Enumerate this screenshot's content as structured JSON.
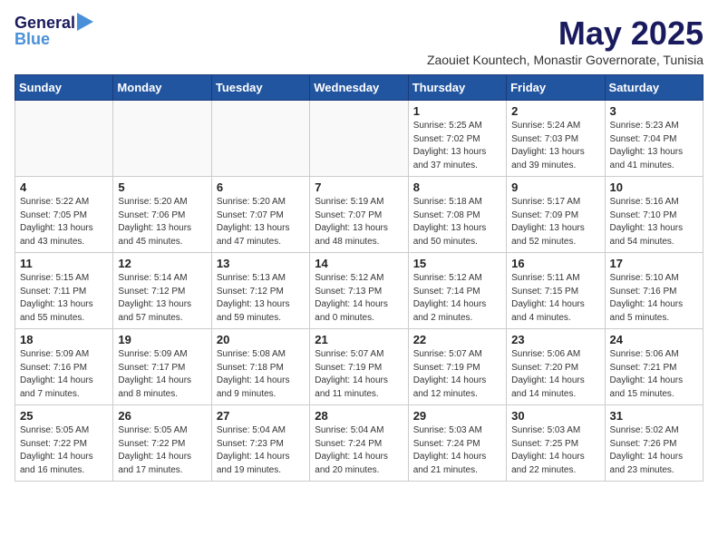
{
  "header": {
    "logo_line1": "General",
    "logo_line2": "Blue",
    "title": "May 2025",
    "subtitle": "Zaouiet Kountech, Monastir Governorate, Tunisia"
  },
  "weekdays": [
    "Sunday",
    "Monday",
    "Tuesday",
    "Wednesday",
    "Thursday",
    "Friday",
    "Saturday"
  ],
  "weeks": [
    [
      {
        "day": "",
        "info": ""
      },
      {
        "day": "",
        "info": ""
      },
      {
        "day": "",
        "info": ""
      },
      {
        "day": "",
        "info": ""
      },
      {
        "day": "1",
        "info": "Sunrise: 5:25 AM\nSunset: 7:02 PM\nDaylight: 13 hours\nand 37 minutes."
      },
      {
        "day": "2",
        "info": "Sunrise: 5:24 AM\nSunset: 7:03 PM\nDaylight: 13 hours\nand 39 minutes."
      },
      {
        "day": "3",
        "info": "Sunrise: 5:23 AM\nSunset: 7:04 PM\nDaylight: 13 hours\nand 41 minutes."
      }
    ],
    [
      {
        "day": "4",
        "info": "Sunrise: 5:22 AM\nSunset: 7:05 PM\nDaylight: 13 hours\nand 43 minutes."
      },
      {
        "day": "5",
        "info": "Sunrise: 5:20 AM\nSunset: 7:06 PM\nDaylight: 13 hours\nand 45 minutes."
      },
      {
        "day": "6",
        "info": "Sunrise: 5:20 AM\nSunset: 7:07 PM\nDaylight: 13 hours\nand 47 minutes."
      },
      {
        "day": "7",
        "info": "Sunrise: 5:19 AM\nSunset: 7:07 PM\nDaylight: 13 hours\nand 48 minutes."
      },
      {
        "day": "8",
        "info": "Sunrise: 5:18 AM\nSunset: 7:08 PM\nDaylight: 13 hours\nand 50 minutes."
      },
      {
        "day": "9",
        "info": "Sunrise: 5:17 AM\nSunset: 7:09 PM\nDaylight: 13 hours\nand 52 minutes."
      },
      {
        "day": "10",
        "info": "Sunrise: 5:16 AM\nSunset: 7:10 PM\nDaylight: 13 hours\nand 54 minutes."
      }
    ],
    [
      {
        "day": "11",
        "info": "Sunrise: 5:15 AM\nSunset: 7:11 PM\nDaylight: 13 hours\nand 55 minutes."
      },
      {
        "day": "12",
        "info": "Sunrise: 5:14 AM\nSunset: 7:12 PM\nDaylight: 13 hours\nand 57 minutes."
      },
      {
        "day": "13",
        "info": "Sunrise: 5:13 AM\nSunset: 7:12 PM\nDaylight: 13 hours\nand 59 minutes."
      },
      {
        "day": "14",
        "info": "Sunrise: 5:12 AM\nSunset: 7:13 PM\nDaylight: 14 hours\nand 0 minutes."
      },
      {
        "day": "15",
        "info": "Sunrise: 5:12 AM\nSunset: 7:14 PM\nDaylight: 14 hours\nand 2 minutes."
      },
      {
        "day": "16",
        "info": "Sunrise: 5:11 AM\nSunset: 7:15 PM\nDaylight: 14 hours\nand 4 minutes."
      },
      {
        "day": "17",
        "info": "Sunrise: 5:10 AM\nSunset: 7:16 PM\nDaylight: 14 hours\nand 5 minutes."
      }
    ],
    [
      {
        "day": "18",
        "info": "Sunrise: 5:09 AM\nSunset: 7:16 PM\nDaylight: 14 hours\nand 7 minutes."
      },
      {
        "day": "19",
        "info": "Sunrise: 5:09 AM\nSunset: 7:17 PM\nDaylight: 14 hours\nand 8 minutes."
      },
      {
        "day": "20",
        "info": "Sunrise: 5:08 AM\nSunset: 7:18 PM\nDaylight: 14 hours\nand 9 minutes."
      },
      {
        "day": "21",
        "info": "Sunrise: 5:07 AM\nSunset: 7:19 PM\nDaylight: 14 hours\nand 11 minutes."
      },
      {
        "day": "22",
        "info": "Sunrise: 5:07 AM\nSunset: 7:19 PM\nDaylight: 14 hours\nand 12 minutes."
      },
      {
        "day": "23",
        "info": "Sunrise: 5:06 AM\nSunset: 7:20 PM\nDaylight: 14 hours\nand 14 minutes."
      },
      {
        "day": "24",
        "info": "Sunrise: 5:06 AM\nSunset: 7:21 PM\nDaylight: 14 hours\nand 15 minutes."
      }
    ],
    [
      {
        "day": "25",
        "info": "Sunrise: 5:05 AM\nSunset: 7:22 PM\nDaylight: 14 hours\nand 16 minutes."
      },
      {
        "day": "26",
        "info": "Sunrise: 5:05 AM\nSunset: 7:22 PM\nDaylight: 14 hours\nand 17 minutes."
      },
      {
        "day": "27",
        "info": "Sunrise: 5:04 AM\nSunset: 7:23 PM\nDaylight: 14 hours\nand 19 minutes."
      },
      {
        "day": "28",
        "info": "Sunrise: 5:04 AM\nSunset: 7:24 PM\nDaylight: 14 hours\nand 20 minutes."
      },
      {
        "day": "29",
        "info": "Sunrise: 5:03 AM\nSunset: 7:24 PM\nDaylight: 14 hours\nand 21 minutes."
      },
      {
        "day": "30",
        "info": "Sunrise: 5:03 AM\nSunset: 7:25 PM\nDaylight: 14 hours\nand 22 minutes."
      },
      {
        "day": "31",
        "info": "Sunrise: 5:02 AM\nSunset: 7:26 PM\nDaylight: 14 hours\nand 23 minutes."
      }
    ]
  ]
}
